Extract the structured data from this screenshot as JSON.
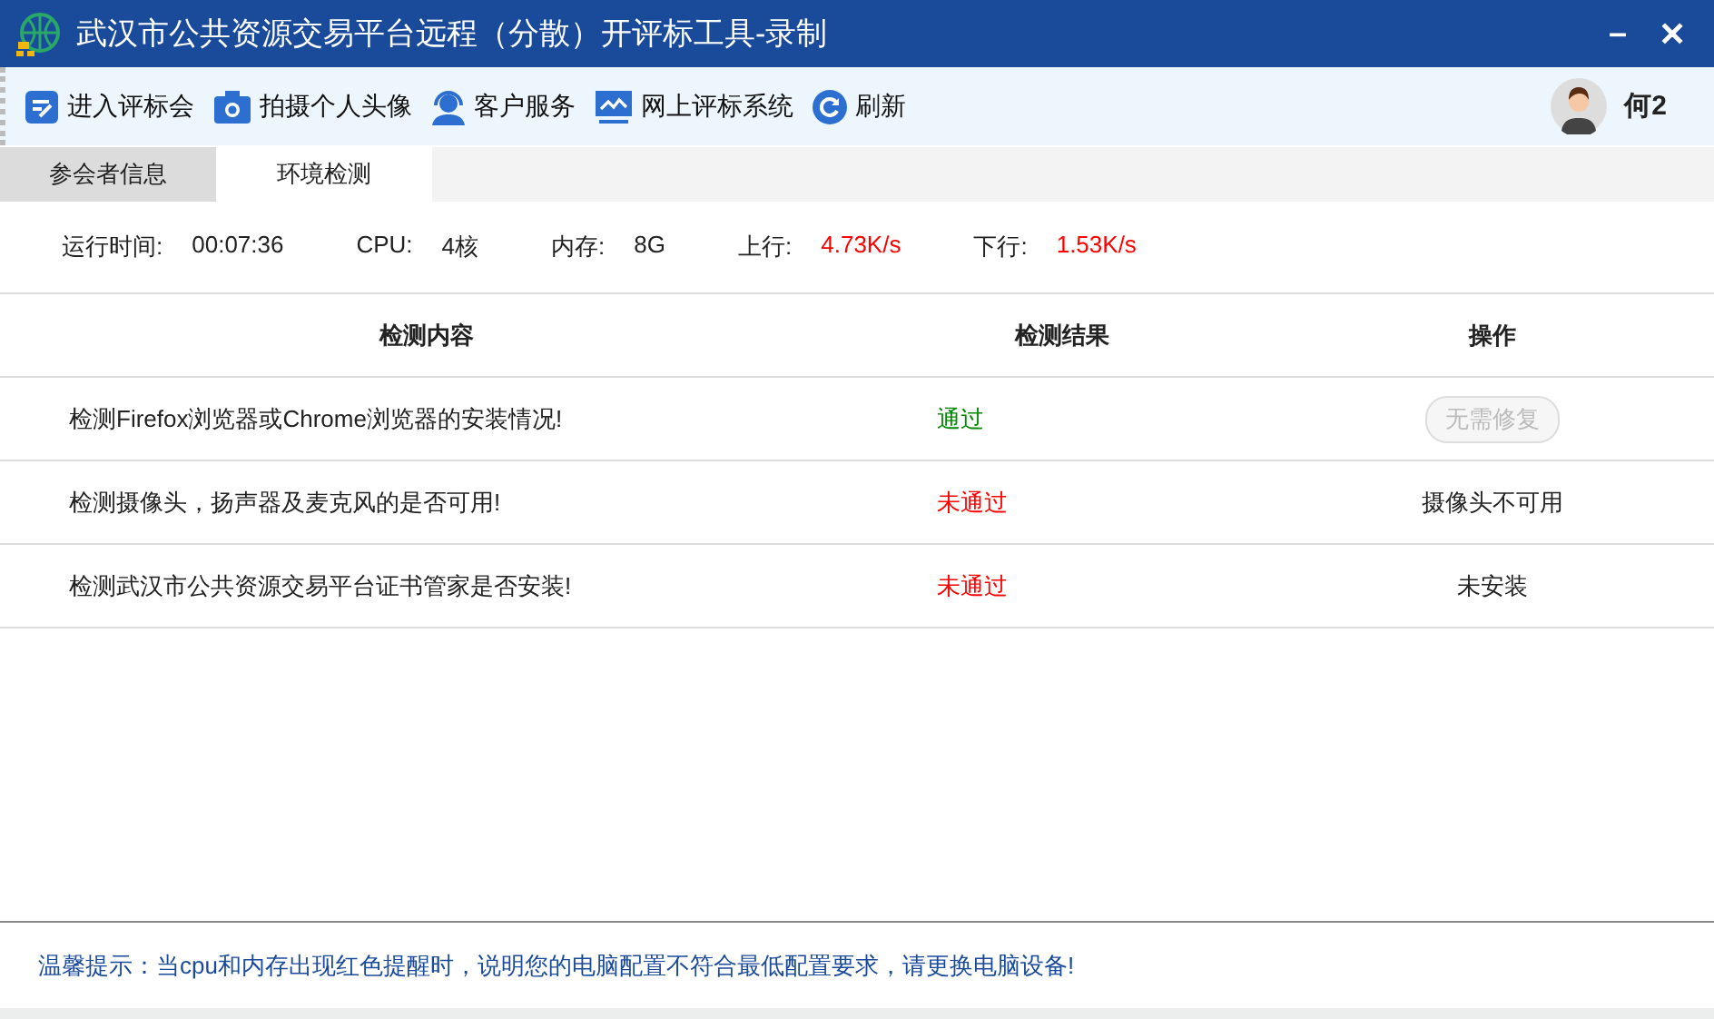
{
  "window": {
    "title": "武汉市公共资源交易平台远程（分散）开评标工具-录制",
    "controls": [
      "–",
      "✕"
    ]
  },
  "toolbar": {
    "items": [
      {
        "label": "进入评标会"
      },
      {
        "label": "拍摄个人头像"
      },
      {
        "label": "客户服务"
      },
      {
        "label": "网上评标系统"
      },
      {
        "label": "刷新"
      }
    ],
    "user": "何2"
  },
  "tabs": [
    {
      "label": "参会者信息",
      "selected": false
    },
    {
      "label": "环境检测",
      "selected": true
    }
  ],
  "stats": [
    {
      "label": "运行时间:",
      "value": "00:07:36",
      "alert": false
    },
    {
      "label": "CPU:",
      "value": "4核",
      "alert": false
    },
    {
      "label": "内存:",
      "value": "8G",
      "alert": false
    },
    {
      "label": "上行:",
      "value": "4.73K/s",
      "alert": true
    },
    {
      "label": "下行:",
      "value": "1.53K/s",
      "alert": true
    }
  ],
  "table": {
    "columns": [
      "检测内容",
      "检测结果",
      "操作"
    ],
    "rows": [
      {
        "content": "检测Firefox浏览器或Chrome浏览器的安装情况!",
        "result": "通过",
        "passed": true,
        "action": {
          "kind": "button",
          "label": "无需修复",
          "disabled": true
        }
      },
      {
        "content": "检测摄像头，扬声器及麦克风的是否可用!",
        "result": "未通过",
        "passed": false,
        "action": {
          "kind": "text",
          "label": "摄像头不可用"
        }
      },
      {
        "content": "检测武汉市公共资源交易平台证书管家是否安装!",
        "result": "未通过",
        "passed": false,
        "action": {
          "kind": "text",
          "label": "未安装"
        }
      }
    ]
  },
  "status_bar": {
    "tip": "温馨提示：当cpu和内存出现红色提醒时，说明您的电脑配置不符合最低配置要求，请更换电脑设备!"
  }
}
